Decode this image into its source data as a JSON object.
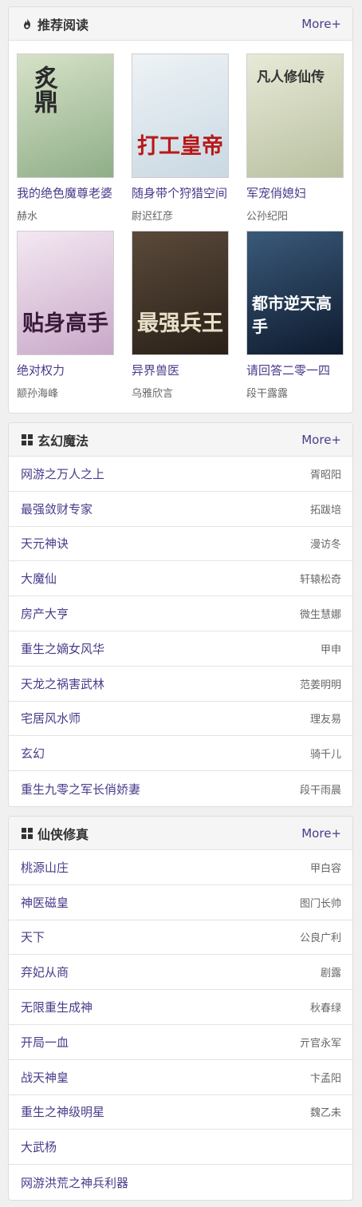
{
  "recommend": {
    "title": "推荐阅读",
    "more": "More+",
    "books": [
      {
        "cover_text": "炙鼎",
        "title": "我的绝色魔尊老婆",
        "author": "赫水",
        "colors": [
          "#d7e2c8",
          "#8fae88"
        ]
      },
      {
        "cover_text": "打工皇帝",
        "title": "随身带个狩猎空间",
        "author": "尉迟红彦",
        "colors": [
          "#eef3f6",
          "#c9d8e2"
        ]
      },
      {
        "cover_text": "凡人修仙传",
        "title": "军宠俏媳妇",
        "author": "公孙纪阳",
        "colors": [
          "#e8ead8",
          "#b8c0a0"
        ]
      },
      {
        "cover_text": "贴身高手",
        "title": "绝对权力",
        "author": "颛孙海峰",
        "colors": [
          "#f4e8f2",
          "#c8a8c8"
        ]
      },
      {
        "cover_text": "最强兵王",
        "title": "异界兽医",
        "author": "乌雅欣言",
        "colors": [
          "#5a4a3a",
          "#2a2018"
        ]
      },
      {
        "cover_text": "都市逆天高手",
        "title": "请回答二零一四",
        "author": "段干露露",
        "colors": [
          "#3a5a7a",
          "#0e1a2e"
        ]
      }
    ]
  },
  "xuanhuan": {
    "title": "玄幻魔法",
    "more": "More+",
    "items": [
      {
        "title": "网游之万人之上",
        "author": "胥昭阳"
      },
      {
        "title": "最强敛财专家",
        "author": "拓跋培"
      },
      {
        "title": "天元神诀",
        "author": "漫访冬"
      },
      {
        "title": "大魔仙",
        "author": "轩辕松奇"
      },
      {
        "title": "房产大亨",
        "author": "微生慧娜"
      },
      {
        "title": "重生之嫡女风华",
        "author": "甲申"
      },
      {
        "title": "天龙之祸害武林",
        "author": "范姜明明"
      },
      {
        "title": "宅居风水师",
        "author": "理友易"
      },
      {
        "title": "玄幻",
        "author": "骑千儿"
      },
      {
        "title": "重生九零之军长俏娇妻",
        "author": "段干雨晨"
      }
    ]
  },
  "xianxia": {
    "title": "仙侠修真",
    "more": "More+",
    "items": [
      {
        "title": "桃源山庄",
        "author": "甲白容"
      },
      {
        "title": "神医磁皇",
        "author": "图门长帅"
      },
      {
        "title": "天下",
        "author": "公良广利"
      },
      {
        "title": "弃妃从商",
        "author": "剧露"
      },
      {
        "title": "无限重生成神",
        "author": "秋春绿"
      },
      {
        "title": "开局一血",
        "author": "亓官永军"
      },
      {
        "title": "战天神皇",
        "author": "卞孟阳"
      },
      {
        "title": "重生之神级明星",
        "author": "魏乙未"
      },
      {
        "title": "大武杨",
        "author": ""
      },
      {
        "title": "网游洪荒之神兵利器",
        "author": ""
      }
    ]
  }
}
